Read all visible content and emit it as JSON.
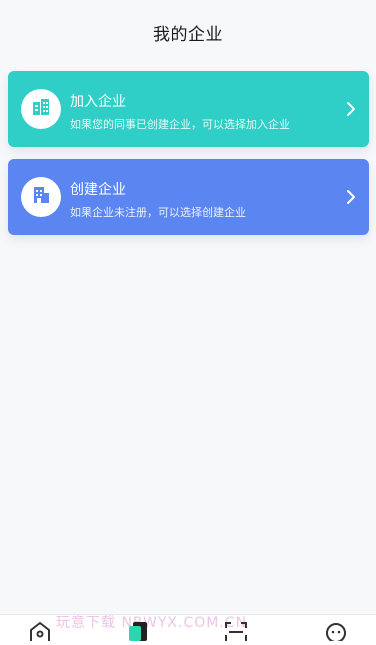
{
  "header": {
    "title": "我的企业"
  },
  "cards": [
    {
      "title": "加入企业",
      "description": "如果您的同事已创建企业，可以选择加入企业",
      "icon": "buildings-icon",
      "color": "#2fcfc7"
    },
    {
      "title": "创建企业",
      "description": "如果企业未注册，可以选择创建企业",
      "icon": "building-icon",
      "color": "#5b86f2"
    }
  ],
  "tabbar": {
    "items": [
      {
        "icon": "home-icon"
      },
      {
        "icon": "cards-icon",
        "active": true
      },
      {
        "icon": "scan-icon"
      },
      {
        "icon": "profile-icon"
      }
    ]
  },
  "watermark": "玩意下载 NBWYX.COM.CN"
}
